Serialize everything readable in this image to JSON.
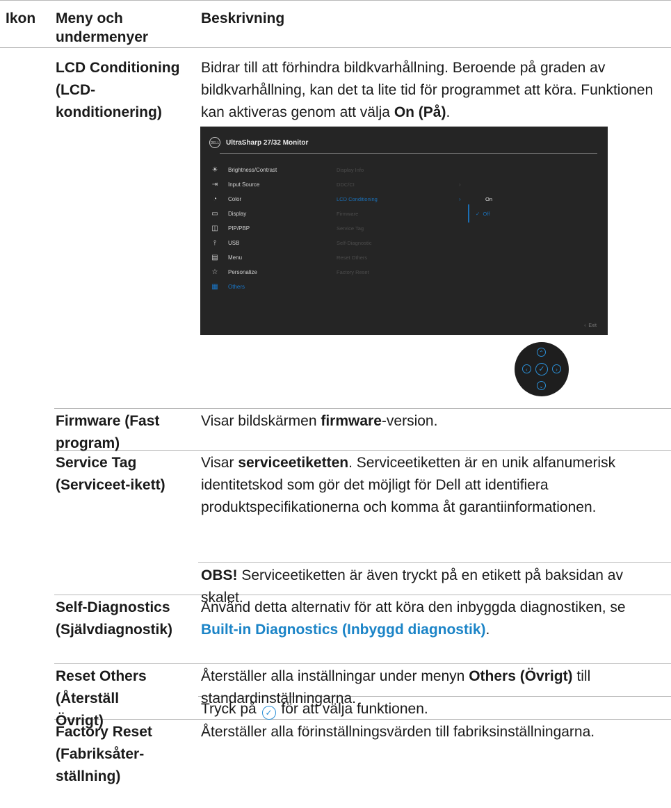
{
  "header": {
    "col_icon": "Ikon",
    "col_menu": "Meny och undermenyer",
    "col_desc": "Beskrivning"
  },
  "rows": {
    "lcd": {
      "menu": "LCD Conditioning (LCD-konditionering)",
      "desc_1": "Bidrar till att förhindra bildkvarhållning. Beroende på graden av bildkvarhållning, kan det ta lite tid för programmet att köra. Funktionen kan aktiveras genom att välja ",
      "desc_bold": "On (På)",
      "desc_end": "."
    },
    "firmware": {
      "menu": "Firmware (Fast program)",
      "desc_1": "Visar bildskärmen ",
      "desc_bold": "firmware",
      "desc_end": "-version."
    },
    "service_tag": {
      "menu": "Service Tag (Serviceet-ikett)",
      "desc_1": "Visar ",
      "desc_bold": "serviceetiketten",
      "desc_end": ". Serviceetiketten är en unik alfanumerisk identitetskod som gör det möjligt för Dell att identifiera produktspecifikationerna och komma åt garantiinformationen.",
      "note_bold": "OBS!",
      "note": " Serviceetiketten är även tryckt på en etikett på baksidan av skalet."
    },
    "self_diag": {
      "menu": "Self-Diagnostics (Självdiagnostik)",
      "desc_1": "Använd detta alternativ för att köra den inbyggda diagnostiken, se ",
      "link": "Built-in Diagnostics (Inbyggd diagnostik)",
      "desc_end": "."
    },
    "reset_others": {
      "menu": "Reset Others (Återställ Övrigt)",
      "desc_1": "Återställer alla inställningar under menyn ",
      "desc_bold": "Others (Övrigt)",
      "desc_end": " till standardinställningarna.",
      "press_1": "Tryck på ",
      "press_2": " för att välja funktionen."
    },
    "factory_reset": {
      "menu": "Factory Reset (Fabriksåter-ställning)",
      "desc": "Återställer alla förinställningsvärden till fabriksinställningarna."
    }
  },
  "osd": {
    "logo": "DELL",
    "title": "UltraSharp 27/32 Monitor",
    "menu_items": [
      {
        "label": "Brightness/Contrast",
        "icon": "brightness-icon"
      },
      {
        "label": "Input Source",
        "icon": "input-source-icon"
      },
      {
        "label": "Color",
        "icon": "color-icon"
      },
      {
        "label": "Display",
        "icon": "display-icon"
      },
      {
        "label": "PIP/PBP",
        "icon": "pip-pbp-icon"
      },
      {
        "label": "USB",
        "icon": "usb-icon"
      },
      {
        "label": "Menu",
        "icon": "menu-icon"
      },
      {
        "label": "Personalize",
        "icon": "star-icon"
      },
      {
        "label": "Others",
        "icon": "others-icon"
      }
    ],
    "submenu": [
      "Display Info",
      "DDC/CI",
      "LCD Conditioning",
      "Firmware",
      "Service Tag",
      "Self-Diagnostic",
      "Reset Others",
      "Factory Reset"
    ],
    "options": [
      "On",
      "Off"
    ],
    "exit": "Exit",
    "accent": "#1b6fb5"
  }
}
